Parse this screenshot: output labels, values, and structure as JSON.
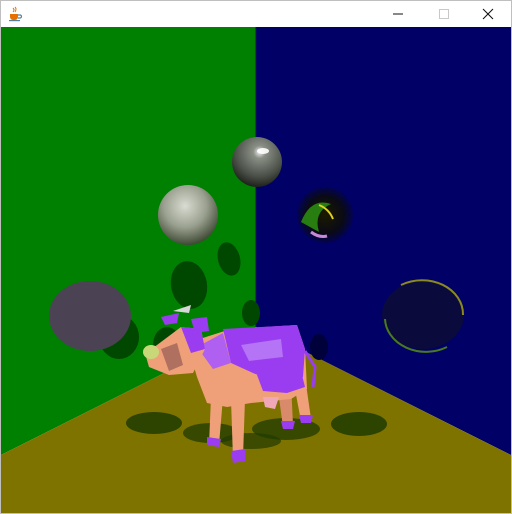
{
  "window": {
    "title": "",
    "icons": {
      "app": "java-cup-icon",
      "minimize": "minimize-icon",
      "maximize": "maximize-icon",
      "close": "close-icon"
    }
  },
  "scene": {
    "colors": {
      "left_wall": "#008000",
      "right_wall": "#000066",
      "floor": "#7f7300",
      "cow_body": "#9a3cf0",
      "cow_patch": "#f0a078",
      "sphere_gray": "#9aa08f",
      "sphere_dark_disc": "#4b4254",
      "shadow": "#1f3b00"
    },
    "objects": [
      "cow",
      "reflective-spheres",
      "wall-shadows",
      "floor-shadows"
    ]
  }
}
